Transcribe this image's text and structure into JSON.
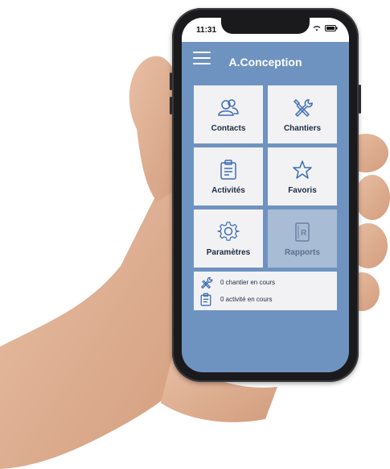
{
  "status_bar": {
    "time": "11:31"
  },
  "app": {
    "title": "A.Conception"
  },
  "tiles": [
    {
      "label": "Contacts",
      "icon": "contacts-icon"
    },
    {
      "label": "Chantiers",
      "icon": "tools-icon"
    },
    {
      "label": "Activités",
      "icon": "clipboard-icon"
    },
    {
      "label": "Favoris",
      "icon": "star-icon"
    },
    {
      "label": "Paramètres",
      "icon": "gear-icon"
    },
    {
      "label": "Rapports",
      "icon": "report-icon",
      "disabled": true
    }
  ],
  "status": {
    "chantiers": "0 chantier en cours",
    "activites": "0 activité en cours"
  },
  "colors": {
    "screen_bg": "#6f93c0",
    "tile_bg": "#f2f2f4",
    "tile_disabled": "#a9bcd5",
    "icon_stroke": "#3d6db3"
  }
}
